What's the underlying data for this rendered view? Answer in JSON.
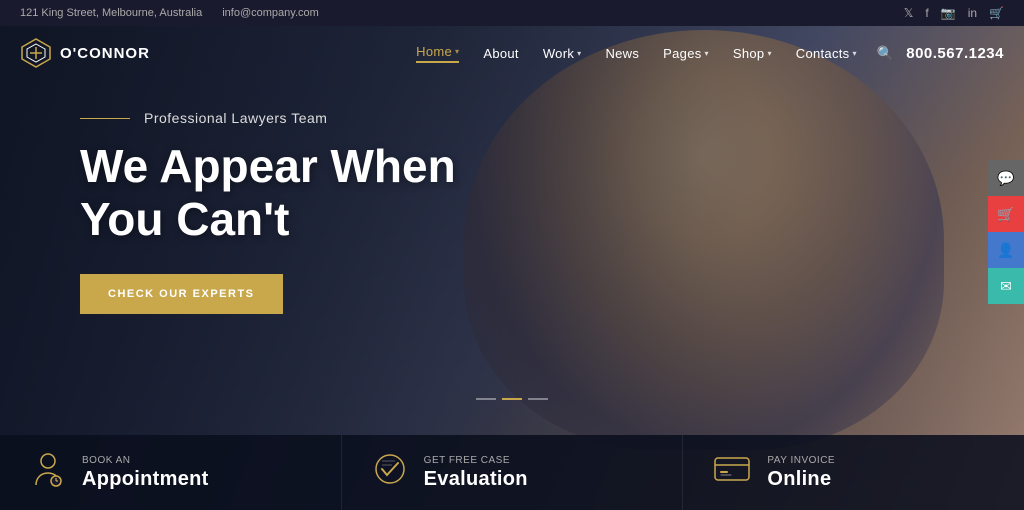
{
  "topbar": {
    "address": "121 King Street, Melbourne, Australia",
    "email": "info@company.com",
    "socials": [
      "twitter",
      "facebook",
      "instagram",
      "linkedin",
      "cart"
    ]
  },
  "logo": {
    "name": "O'CONNOR"
  },
  "nav": {
    "links": [
      {
        "label": "Home",
        "active": true,
        "has_arrow": true
      },
      {
        "label": "About",
        "active": false,
        "has_arrow": false
      },
      {
        "label": "Work",
        "active": false,
        "has_arrow": true
      },
      {
        "label": "News",
        "active": false,
        "has_arrow": false
      },
      {
        "label": "Pages",
        "active": false,
        "has_arrow": true
      },
      {
        "label": "Shop",
        "active": false,
        "has_arrow": true
      },
      {
        "label": "Contacts",
        "active": false,
        "has_arrow": true
      }
    ],
    "phone": "800.567.1234"
  },
  "hero": {
    "subtitle": "Professional Lawyers Team",
    "title_line1": "We Appear When",
    "title_line2": "You Can't",
    "cta_label": "CHECK OUR EXPERTS"
  },
  "bottom_bar": [
    {
      "small_label": "BOOK AN",
      "big_label": "Appointment",
      "icon": "person"
    },
    {
      "small_label": "GET FREE CASE",
      "big_label": "Evaluation",
      "icon": "check"
    },
    {
      "small_label": "PAY INVOICE",
      "big_label": "Online",
      "icon": "card"
    }
  ],
  "sidebar_float": [
    {
      "icon": "chat",
      "color": "grey"
    },
    {
      "icon": "cart",
      "color": "red"
    },
    {
      "icon": "user",
      "color": "blue"
    },
    {
      "icon": "mail",
      "color": "teal"
    }
  ],
  "slider_dots": [
    "dot1",
    "dot2",
    "dot3"
  ]
}
